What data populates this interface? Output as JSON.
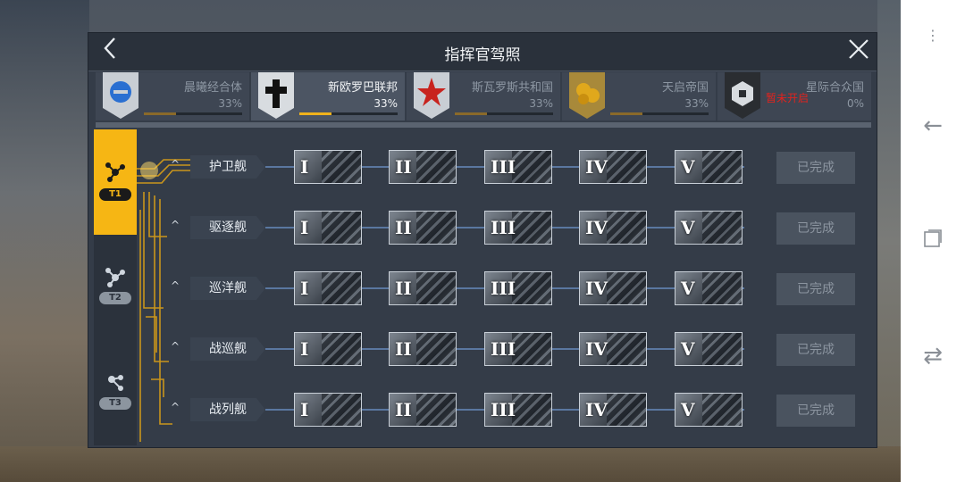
{
  "window": {
    "title": "指挥官驾照",
    "back_icon": "chevron-left-icon",
    "close_icon": "close-icon"
  },
  "factions": [
    {
      "name": "晨曦经合体",
      "pct": "33%",
      "progress": 0.33,
      "active": false,
      "emblem_color": "#2a6fd1"
    },
    {
      "name": "新欧罗巴联邦",
      "pct": "33%",
      "progress": 0.33,
      "active": true,
      "emblem_color": "#111111"
    },
    {
      "name": "斯瓦罗斯共和国",
      "pct": "33%",
      "progress": 0.33,
      "active": false,
      "emblem_color": "#c8231e"
    },
    {
      "name": "天启帝国",
      "pct": "33%",
      "progress": 0.33,
      "active": false,
      "emblem_color": "#e0a81c"
    },
    {
      "name": "星际合众国",
      "pct": "0%",
      "progress": 0,
      "active": false,
      "locked_text": "暂未开启",
      "emblem_color": "#1a1a1a"
    }
  ],
  "tiers": [
    {
      "label": "T1",
      "active": true
    },
    {
      "label": "T2",
      "active": false
    },
    {
      "label": "T3",
      "active": false
    }
  ],
  "rows": [
    {
      "ship": "护卫舰",
      "stages": [
        "I",
        "II",
        "III",
        "IV",
        "V"
      ],
      "status": "已完成"
    },
    {
      "ship": "驱逐舰",
      "stages": [
        "I",
        "II",
        "III",
        "IV",
        "V"
      ],
      "status": "已完成"
    },
    {
      "ship": "巡洋舰",
      "stages": [
        "I",
        "II",
        "III",
        "IV",
        "V"
      ],
      "status": "已完成"
    },
    {
      "ship": "战巡舰",
      "stages": [
        "I",
        "II",
        "III",
        "IV",
        "V"
      ],
      "status": "已完成"
    },
    {
      "ship": "战列舰",
      "stages": [
        "I",
        "II",
        "III",
        "IV",
        "V"
      ],
      "status": "已完成"
    }
  ],
  "colors": {
    "accent": "#f6b614",
    "panel": "#343c48",
    "locked": "#e0231e"
  },
  "system_nav": {
    "icons": [
      "menu-icon",
      "back-arrow-icon",
      "recent-apps-icon",
      "switch-icon"
    ]
  }
}
